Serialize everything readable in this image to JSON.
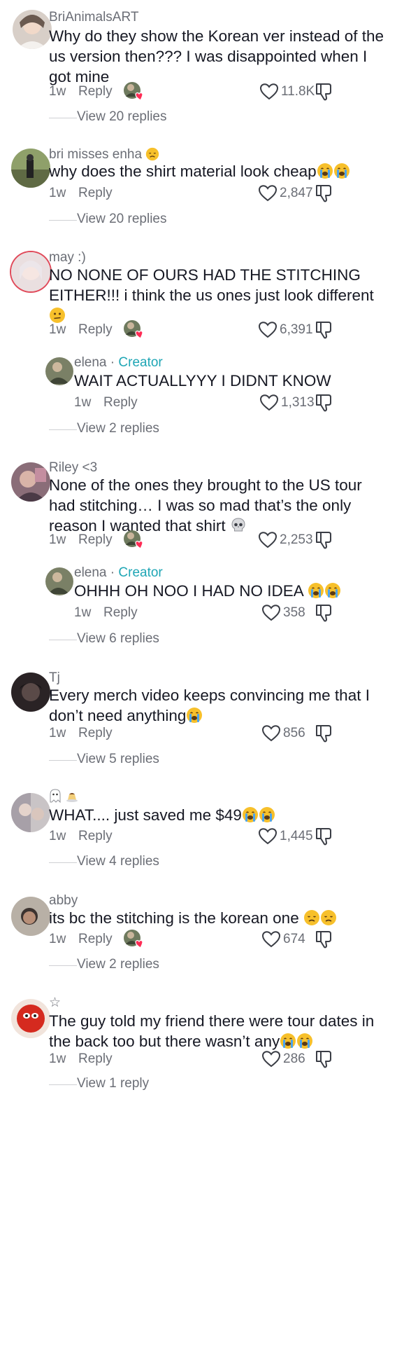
{
  "comments": [
    {
      "username": "BriAnimalsART",
      "text": "Why do they show the Korean ver instead of the us version then??? I was disappointed when I got mine",
      "time": "1w",
      "reply": "Reply",
      "likes": "11.8K",
      "replies": "View 20 replies"
    },
    {
      "username": "bri misses enha",
      "text": "why does the shirt material look cheap",
      "time": "1w",
      "reply": "Reply",
      "likes": "2,847",
      "replies": "View 20 replies"
    },
    {
      "username": "may :)",
      "text": "NO NONE OF OURS HAD THE STITCHING EITHER!!! i think the us ones just look different",
      "time": "1w",
      "reply": "Reply",
      "likes": "6,391",
      "replies": "View 2 replies",
      "creator_reply": {
        "username": "elena",
        "creator_label": "Creator",
        "text": "WAIT ACTUALLYYY I DIDNT KNOW",
        "time": "1w",
        "reply": "Reply",
        "likes": "1,313"
      }
    },
    {
      "username": "Riley <3",
      "text": "None of the ones they brought to the US tour had stitching… I was so mad that’s the only reason I wanted that shirt",
      "time": "1w",
      "reply": "Reply",
      "likes": "2,253",
      "replies": "View 6 replies",
      "creator_reply": {
        "username": "elena",
        "creator_label": "Creator",
        "text": "OHHH OH NOO I HAD NO IDEA",
        "time": "1w",
        "reply": "Reply",
        "likes": "358"
      }
    },
    {
      "username": "Tj",
      "text": "Every merch video keeps convincing me that I don’t need anything",
      "time": "1w",
      "reply": "Reply",
      "likes": "856",
      "replies": "View 5 replies"
    },
    {
      "username": "",
      "text": "WHAT.... just saved me $49",
      "time": "1w",
      "reply": "Reply",
      "likes": "1,445",
      "replies": "View 4 replies"
    },
    {
      "username": "abby",
      "text": "its bc the stitching is the korean one",
      "time": "1w",
      "reply": "Reply",
      "likes": "674",
      "replies": "View 2 replies"
    },
    {
      "username": "☆",
      "text": "The guy told my friend there were tour dates in the back too but there wasn’t any",
      "time": "1w",
      "reply": "Reply",
      "likes": "286",
      "replies": "View 1 reply"
    }
  ],
  "icons": {
    "like": "heart-outline-icon",
    "dislike": "thumbs-down-icon",
    "liked_by_creator": "creator-liked-avatar-icon",
    "emoji_crying": "loudly-crying-emoji",
    "emoji_confused": "confused-emoji",
    "emoji_skull": "skull-emoji",
    "emoji_disappointed": "disappointed-emoji"
  },
  "colors": {
    "creator": "#1fa6b5",
    "text": "#161823",
    "meta": "#6b6e76"
  }
}
